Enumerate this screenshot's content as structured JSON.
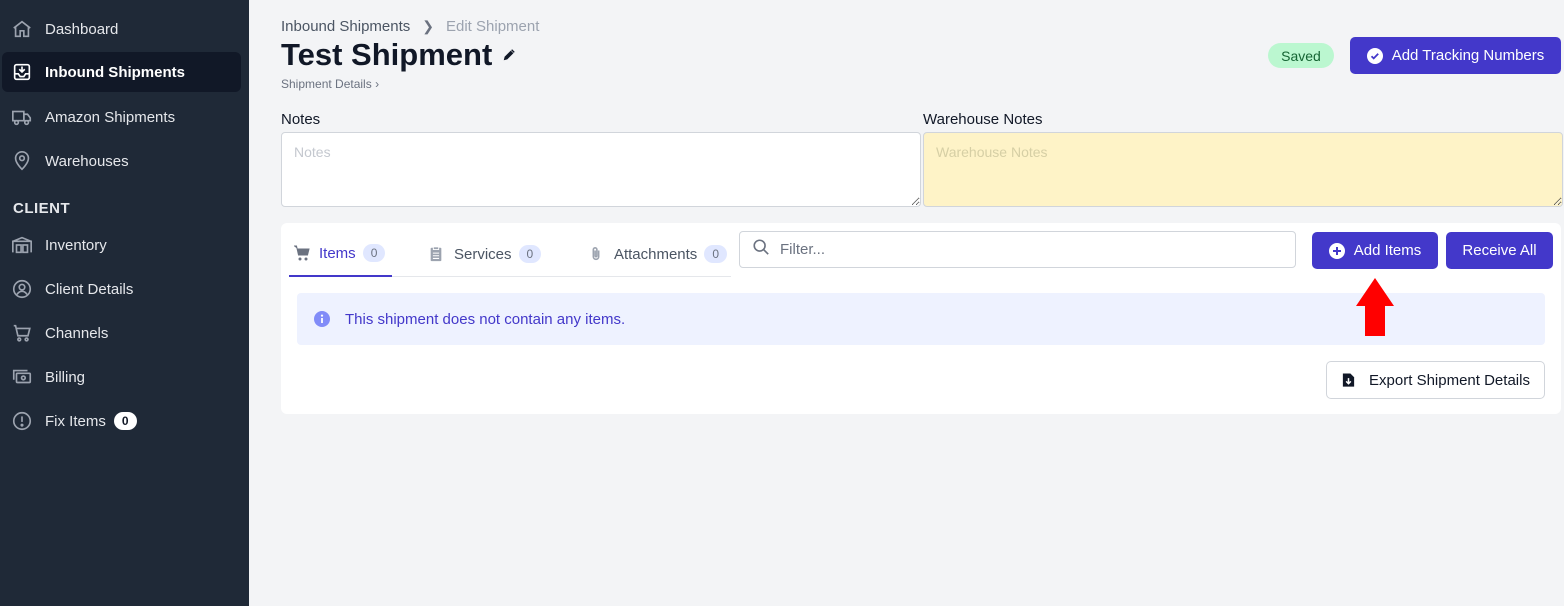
{
  "sidebar": {
    "items": [
      {
        "label": "Dashboard",
        "icon": "home-icon",
        "active": false
      },
      {
        "label": "Inbound Shipments",
        "icon": "inbox-download-icon",
        "active": true
      },
      {
        "label": "Amazon Shipments",
        "icon": "truck-icon",
        "active": false
      },
      {
        "label": "Warehouses",
        "icon": "map-pin-icon",
        "active": false
      }
    ],
    "section_label": "CLIENT",
    "client_items": [
      {
        "label": "Inventory",
        "icon": "warehouse-shelves-icon"
      },
      {
        "label": "Client Details",
        "icon": "user-circle-icon"
      },
      {
        "label": "Channels",
        "icon": "shopping-cart-icon"
      },
      {
        "label": "Billing",
        "icon": "cash-icon"
      },
      {
        "label": "Fix Items",
        "icon": "alert-circle-icon",
        "badge": "0"
      }
    ]
  },
  "header": {
    "breadcrumb": [
      "Inbound Shipments",
      "Edit Shipment"
    ],
    "title": "Test Shipment",
    "sub_link": "Shipment Details",
    "status": "Saved",
    "tracking_button": "Add Tracking Numbers"
  },
  "notes": {
    "label": "Notes",
    "placeholder": "Notes",
    "warehouse_label": "Warehouse Notes",
    "warehouse_placeholder": "Warehouse Notes"
  },
  "tabs": [
    {
      "label": "Items",
      "count": "0",
      "icon": "cart-icon",
      "active": true
    },
    {
      "label": "Services",
      "count": "0",
      "icon": "clipboard-list-icon",
      "active": false
    },
    {
      "label": "Attachments",
      "count": "0",
      "icon": "paperclip-icon",
      "active": false
    }
  ],
  "filter": {
    "placeholder": "Filter..."
  },
  "actions": {
    "add_items": "Add Items",
    "receive_all": "Receive All",
    "export": "Export Shipment Details"
  },
  "alert": {
    "message": "This shipment does not contain any items."
  },
  "colors": {
    "primary": "#4338ca",
    "sidebar": "#1f2937",
    "saved_bg": "#bbf7d0",
    "warehouse_notes_bg": "#fef3c7",
    "annotation_arrow": "#ff0000"
  }
}
